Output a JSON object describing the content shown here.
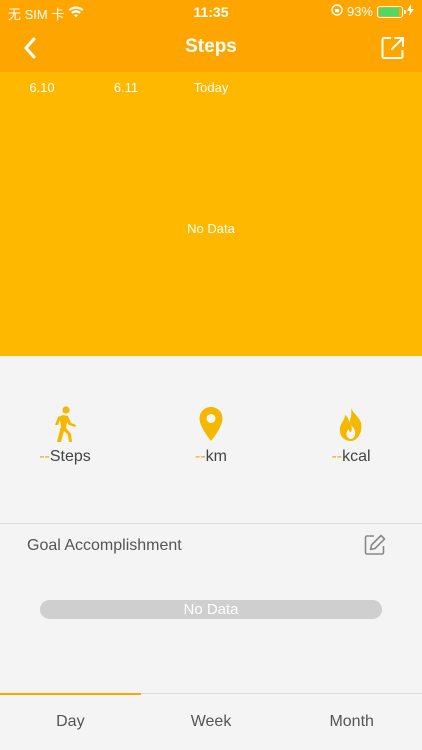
{
  "status_bar": {
    "carrier": "无 SIM 卡",
    "time": "11:35",
    "battery": "93%"
  },
  "nav": {
    "title": "Steps"
  },
  "chart": {
    "dates": [
      "6.10",
      "6.11",
      "Today"
    ],
    "no_data": "No Data"
  },
  "stats": [
    {
      "icon": "walking-person-icon",
      "value": "--",
      "unit": "Steps"
    },
    {
      "icon": "location-pin-icon",
      "value": "--",
      "unit": "km"
    },
    {
      "icon": "flame-icon",
      "value": "--",
      "unit": "kcal"
    }
  ],
  "goal": {
    "title": "Goal Accomplishment",
    "bar_text": "No Data"
  },
  "tabs": [
    "Day",
    "Week",
    "Month"
  ],
  "colors": {
    "header": "#ffa500",
    "chart_bg": "#ffb800",
    "accent": "#f5a623",
    "battery": "#4cd964"
  }
}
